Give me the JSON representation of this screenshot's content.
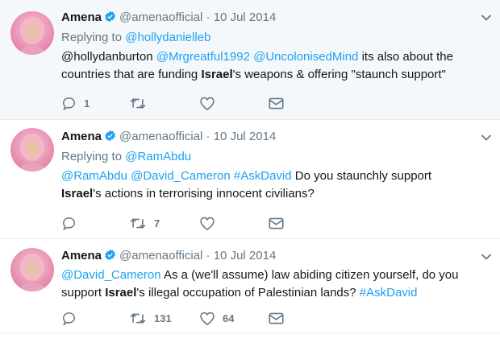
{
  "tweets": [
    {
      "name": "Amena",
      "handle": "@amenaofficial",
      "separator": "·",
      "date": "10 Jul 2014",
      "reply_prefix": "Replying to ",
      "reply_to": "@hollydanielleb",
      "text_parts": {
        "p0": "@hollydanburton ",
        "m1": "@Mrgreatful1992",
        "s1": " ",
        "m2": "@UncolonisedMind",
        "p1": " its also about the countries that are funding ",
        "bold": "Israel",
        "p2": "'s weapons & offering \"staunch support\""
      },
      "replies": "1",
      "retweets": "",
      "likes": ""
    },
    {
      "name": "Amena",
      "handle": "@amenaofficial",
      "separator": "·",
      "date": "10 Jul 2014",
      "reply_prefix": "Replying to ",
      "reply_to": "@RamAbdu",
      "text_parts": {
        "m1": "@RamAbdu",
        "s1": " ",
        "m2": "@David_Cameron",
        "s2": " ",
        "m3": "#AskDavid",
        "p1": " Do you staunchly support ",
        "bold": "Israel",
        "p2": "'s actions in terrorising innocent civilians?"
      },
      "replies": "",
      "retweets": "7",
      "likes": ""
    },
    {
      "name": "Amena",
      "handle": "@amenaofficial",
      "separator": "·",
      "date": "10 Jul 2014",
      "text_parts": {
        "m1": "@David_Cameron",
        "p1": " As a (we'll assume) law abiding citizen yourself, do you support ",
        "bold": "Israel",
        "p2": "'s illegal occupation of Palestinian lands? ",
        "m2": "#AskDavid"
      },
      "replies": "",
      "retweets": "131",
      "likes": "64"
    }
  ],
  "icons": {
    "verified": "verified-badge-icon",
    "caret": "chevron-down-icon",
    "reply": "reply-icon",
    "retweet": "retweet-icon",
    "like": "heart-icon",
    "dm": "envelope-icon"
  },
  "colors": {
    "link": "#1da1f2",
    "muted": "#657786",
    "highlight_bg": "#f5f8fa",
    "verified": "#1da1f2"
  }
}
